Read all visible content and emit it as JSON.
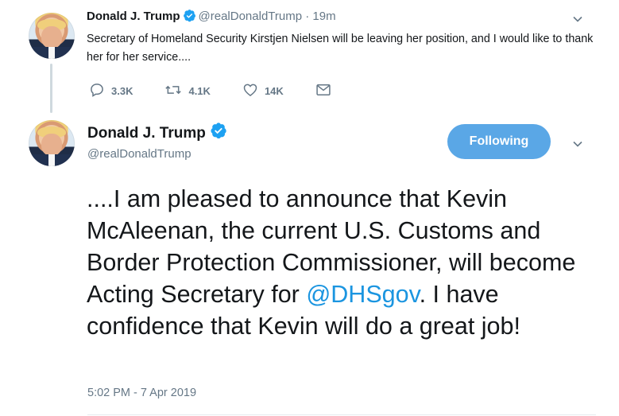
{
  "tweet1": {
    "name": "Donald J. Trump",
    "handle": "@realDonaldTrump",
    "sep": " · ",
    "time": "19m",
    "text": "Secretary of Homeland Security Kirstjen Nielsen will be leaving her position, and I would like to thank her for her service....",
    "replies": "3.3K",
    "retweets": "4.1K",
    "likes": "14K",
    "icons": [
      "verified-icon",
      "reply-icon",
      "retweet-icon",
      "like-icon",
      "message-icon",
      "chevron-down-icon"
    ]
  },
  "tweet2": {
    "name": "Donald J. Trump",
    "handle": "@realDonaldTrump",
    "follow_label": "Following",
    "text_before": "....I am pleased to announce that Kevin McAleenan, the current U.S. Customs and Border Protection Commissioner, will become Acting Secretary for ",
    "mention": "@DHSgov",
    "text_after": ". I have confidence that Kevin will do a great job!",
    "timestamp": "5:02 PM - 7 Apr 2019",
    "icons": [
      "verified-icon",
      "chevron-down-icon"
    ]
  },
  "colors": {
    "accent": "#1b95e0",
    "follow_button": "#5aa7e6",
    "secondary_text": "#657786"
  }
}
